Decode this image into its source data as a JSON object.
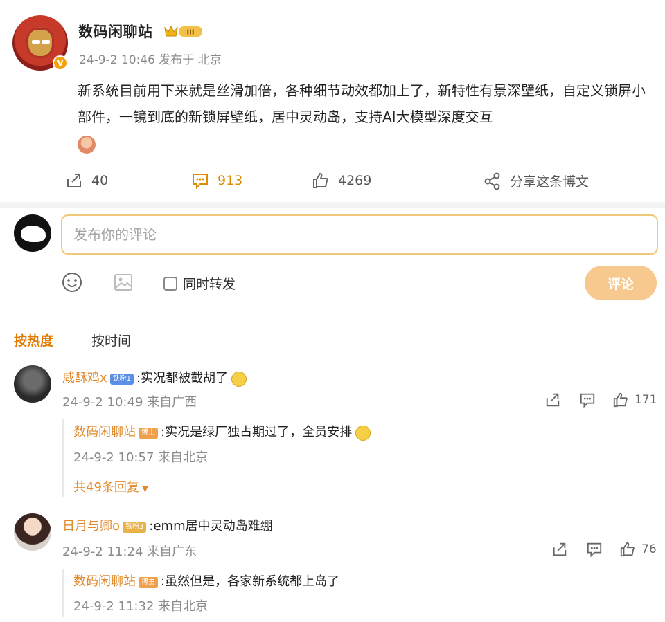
{
  "post": {
    "author": "数码闲聊站",
    "meta": "24-9-2 10:46 发布于 北京",
    "body": "新系统目前用下来就是丝滑加倍，各种细节动效都加上了，新特性有景深壁纸，自定义锁屏小部件，一镜到底的新锁屏壁纸，居中灵动岛，支持AI大模型深度交互",
    "reposts": "40",
    "comments": "913",
    "likes": "4269",
    "share_label": "分享这条博文",
    "crown_level": "III"
  },
  "composer": {
    "placeholder": "发布你的评论",
    "repost_label": "同时转发",
    "submit_label": "评论"
  },
  "sort": {
    "hot": "按热度",
    "time": "按时间"
  },
  "comments": [
    {
      "name": "咸酥鸡x",
      "badge": "铁粉1",
      "text": ":实况都被截胡了",
      "meta": "24-9-2 10:49 来自广西",
      "likes": "171",
      "reply": {
        "name": "数码闲聊站",
        "badge": "博主",
        "text": ":实况是绿厂独占期过了，全员安排",
        "meta": "24-9-2 10:57 来自北京"
      },
      "more": "共49条回复"
    },
    {
      "name": "日月与卿o",
      "badge": "铁粉3",
      "text": ":emm居中灵动岛难绷",
      "meta": "24-9-2 11:24 来自广东",
      "likes": "76",
      "reply": {
        "name": "数码闲聊站",
        "badge": "博主",
        "text": ":虽然但是，各家新系统都上岛了",
        "meta": "24-9-2 11:32 来自北京"
      }
    }
  ],
  "colors": {
    "accent": "#e0892a",
    "comment_count": "#e08a00",
    "input_border": "#f0c87a",
    "submit_bg": "#f7c98e",
    "fan_badge": "#5b8ee6",
    "fan_badge_gold": "#e7b24a",
    "host_badge": "#f0a04b"
  }
}
